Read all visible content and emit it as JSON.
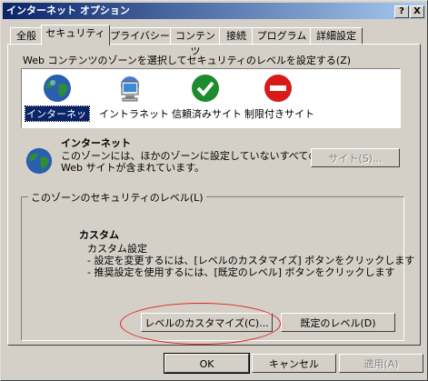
{
  "window": {
    "title": "インターネット オプション",
    "help_btn": "?",
    "close_btn": "X"
  },
  "tabs": [
    {
      "label": "全般"
    },
    {
      "label": "セキュリティ"
    },
    {
      "label": "プライバシー"
    },
    {
      "label": "コンテンツ"
    },
    {
      "label": "接続"
    },
    {
      "label": "プログラム"
    },
    {
      "label": "詳細設定"
    }
  ],
  "zone_prompt": "Web コンテンツのゾーンを選択してセキュリティのレベルを設定する(Z)",
  "zones": [
    {
      "label": "インターネット",
      "icon": "globe-icon",
      "selected": true
    },
    {
      "label": "イントラネット",
      "icon": "computer-icon",
      "selected": false
    },
    {
      "label": "信頼済みサイト",
      "icon": "checkmark-icon",
      "selected": false
    },
    {
      "label": "制限付きサイト",
      "icon": "no-entry-icon",
      "selected": false
    }
  ],
  "zone_info": {
    "title": "インターネット",
    "desc1": "このゾーンには、ほかのゾーンに設定していないすべての",
    "desc2": "Web サイトが含まれています。",
    "sites_btn": "サイト(S)..."
  },
  "security_level": {
    "group_label": "このゾーンのセキュリティのレベル(L)",
    "title": "カスタム",
    "line1": "カスタム設定",
    "line2": "- 設定を変更するには、[レベルのカスタマイズ] ボタンをクリックします",
    "line3": "- 推奨設定を使用するには、[既定のレベル] ボタンをクリックします",
    "customize_btn": "レベルのカスタマイズ(C)...",
    "default_btn": "既定のレベル(D)"
  },
  "footer": {
    "ok": "OK",
    "cancel": "キャンセル",
    "apply": "適用(A)"
  },
  "colors": {
    "title_bar": "#0a246a",
    "highlight_ellipse": "#e02020",
    "face": "#d4d0c8"
  }
}
